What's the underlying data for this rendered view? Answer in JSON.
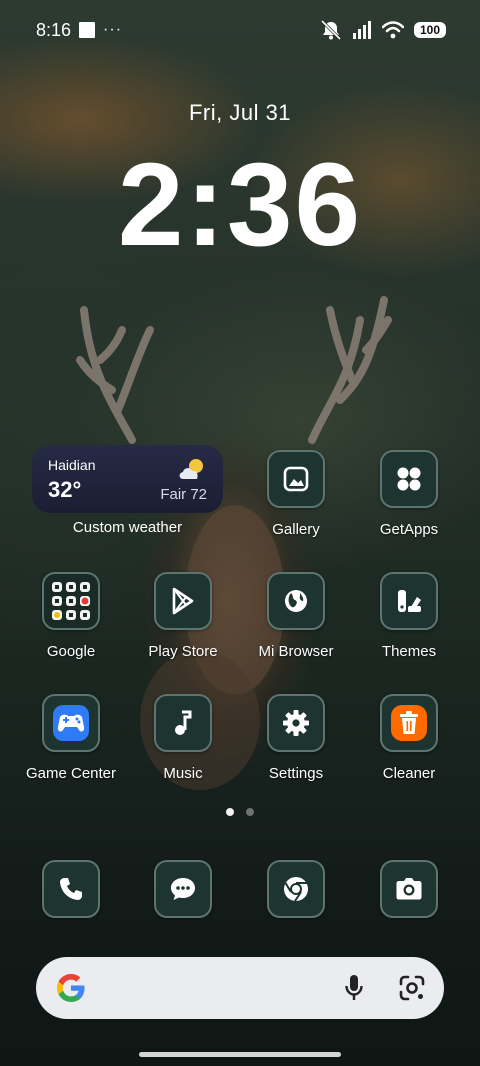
{
  "status_bar": {
    "time": "8:16",
    "more_indicator": "···",
    "battery": "100"
  },
  "lock": {
    "date": "Fri, Jul 31",
    "time": "2:36"
  },
  "weather_widget": {
    "city": "Haidian",
    "temperature": "32°",
    "condition": "Fair 72",
    "label": "Custom weather"
  },
  "apps_row1": [
    {
      "label": "Gallery",
      "icon": "gallery-icon"
    },
    {
      "label": "GetApps",
      "icon": "getapps-icon"
    }
  ],
  "apps_row2": [
    {
      "label": "Google",
      "icon": "google-folder-icon"
    },
    {
      "label": "Play Store",
      "icon": "play-store-icon"
    },
    {
      "label": "Mi Browser",
      "icon": "globe-icon"
    },
    {
      "label": "Themes",
      "icon": "themes-icon"
    }
  ],
  "apps_row3": [
    {
      "label": "Game Center",
      "icon": "game-controller-icon"
    },
    {
      "label": "Music",
      "icon": "music-note-icon"
    },
    {
      "label": "Settings",
      "icon": "gear-icon"
    },
    {
      "label": "Cleaner",
      "icon": "trash-icon"
    }
  ],
  "page_indicator": {
    "pages": 2,
    "current": 1
  },
  "dock": [
    {
      "icon": "phone-icon"
    },
    {
      "icon": "messages-icon"
    },
    {
      "icon": "chrome-icon"
    },
    {
      "icon": "camera-icon"
    }
  ],
  "search_bar": {
    "logo": "google-g-logo",
    "mic_icon": "microphone-icon",
    "lens_icon": "google-lens-icon"
  },
  "colors": {
    "icon_bg": "#1e3430",
    "icon_border": "#5d7470",
    "game_center": "#2f7bf6",
    "cleaner": "#ff6a00",
    "widget_bg": "#222640"
  }
}
